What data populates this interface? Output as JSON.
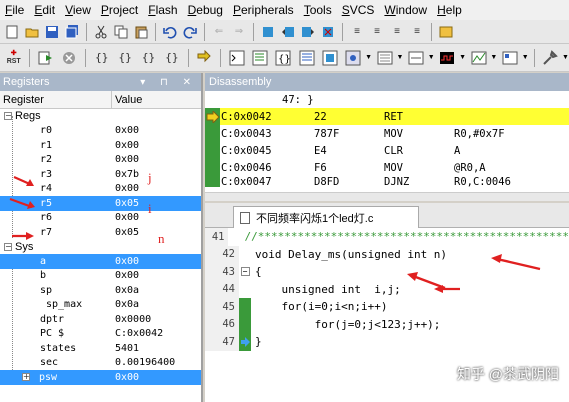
{
  "menu": [
    "File",
    "Edit",
    "View",
    "Project",
    "Flash",
    "Debug",
    "Peripherals",
    "Tools",
    "SVCS",
    "Window",
    "Help"
  ],
  "toolbar2": {
    "rst_label": "RST"
  },
  "registers": {
    "title": "Registers",
    "header": {
      "col_register": "Register",
      "col_value": "Value"
    },
    "regs_group": "Regs",
    "regs": [
      {
        "name": "r0",
        "value": "0x00"
      },
      {
        "name": "r1",
        "value": "0x00"
      },
      {
        "name": "r2",
        "value": "0x00"
      },
      {
        "name": "r3",
        "value": "0x7b"
      },
      {
        "name": "r4",
        "value": "0x00"
      },
      {
        "name": "r5",
        "value": "0x05"
      },
      {
        "name": "r6",
        "value": "0x00"
      },
      {
        "name": "r7",
        "value": "0x05"
      }
    ],
    "sys_group": "Sys",
    "sys": [
      {
        "name": "a",
        "value": "0x00"
      },
      {
        "name": "b",
        "value": "0x00"
      },
      {
        "name": "sp",
        "value": "0x0a"
      },
      {
        "name": "sp_max",
        "value": "0x0a"
      },
      {
        "name": "dptr",
        "value": "0x0000"
      },
      {
        "name": "PC  $",
        "value": "C:0x0042"
      },
      {
        "name": "states",
        "value": "5401"
      },
      {
        "name": "sec",
        "value": "0.00196400"
      },
      {
        "name": "psw",
        "value": "0x00"
      }
    ]
  },
  "disassembly": {
    "title": "Disassembly",
    "rows": [
      {
        "addr": "47: }",
        "hex": "",
        "mnemonic": "",
        "operand": ""
      },
      {
        "addr": "C:0x0042",
        "hex": "22",
        "mnemonic": "RET",
        "operand": ""
      },
      {
        "addr": "C:0x0043",
        "hex": "787F",
        "mnemonic": "MOV",
        "operand": "R0,#0x7F"
      },
      {
        "addr": "C:0x0045",
        "hex": "E4",
        "mnemonic": "CLR",
        "operand": "A"
      },
      {
        "addr": "C:0x0046",
        "hex": "F6",
        "mnemonic": "MOV",
        "operand": "@R0,A"
      },
      {
        "addr": "C:0x0047",
        "hex": "D8FD",
        "mnemonic": "DJNZ",
        "operand": "R0,C:0046"
      }
    ]
  },
  "editor": {
    "tab_label": "不同频率闪烁1个led灯.c",
    "lines": [
      {
        "no": "41",
        "text": "//***********************************************",
        "comment": true
      },
      {
        "no": "42",
        "text": "void Delay_ms(unsigned int n)"
      },
      {
        "no": "43",
        "text": "{"
      },
      {
        "no": "44",
        "text": "    unsigned int  i,j;"
      },
      {
        "no": "45",
        "text": "    for(i=0;i<n;i++)"
      },
      {
        "no": "46",
        "text": "         for(j=0;j<123;j++);"
      },
      {
        "no": "47",
        "text": "}"
      }
    ]
  },
  "annotations": {
    "j": "j",
    "i": "i",
    "n": "n"
  },
  "watermark": "知乎 @茶武阴阳",
  "colors": {
    "selection": "#3399ff",
    "current_line": "#ffff33",
    "gutter_green": "#3a9a3a",
    "panel_title": "#a9b7c9",
    "annotation_red": "#e02020"
  }
}
